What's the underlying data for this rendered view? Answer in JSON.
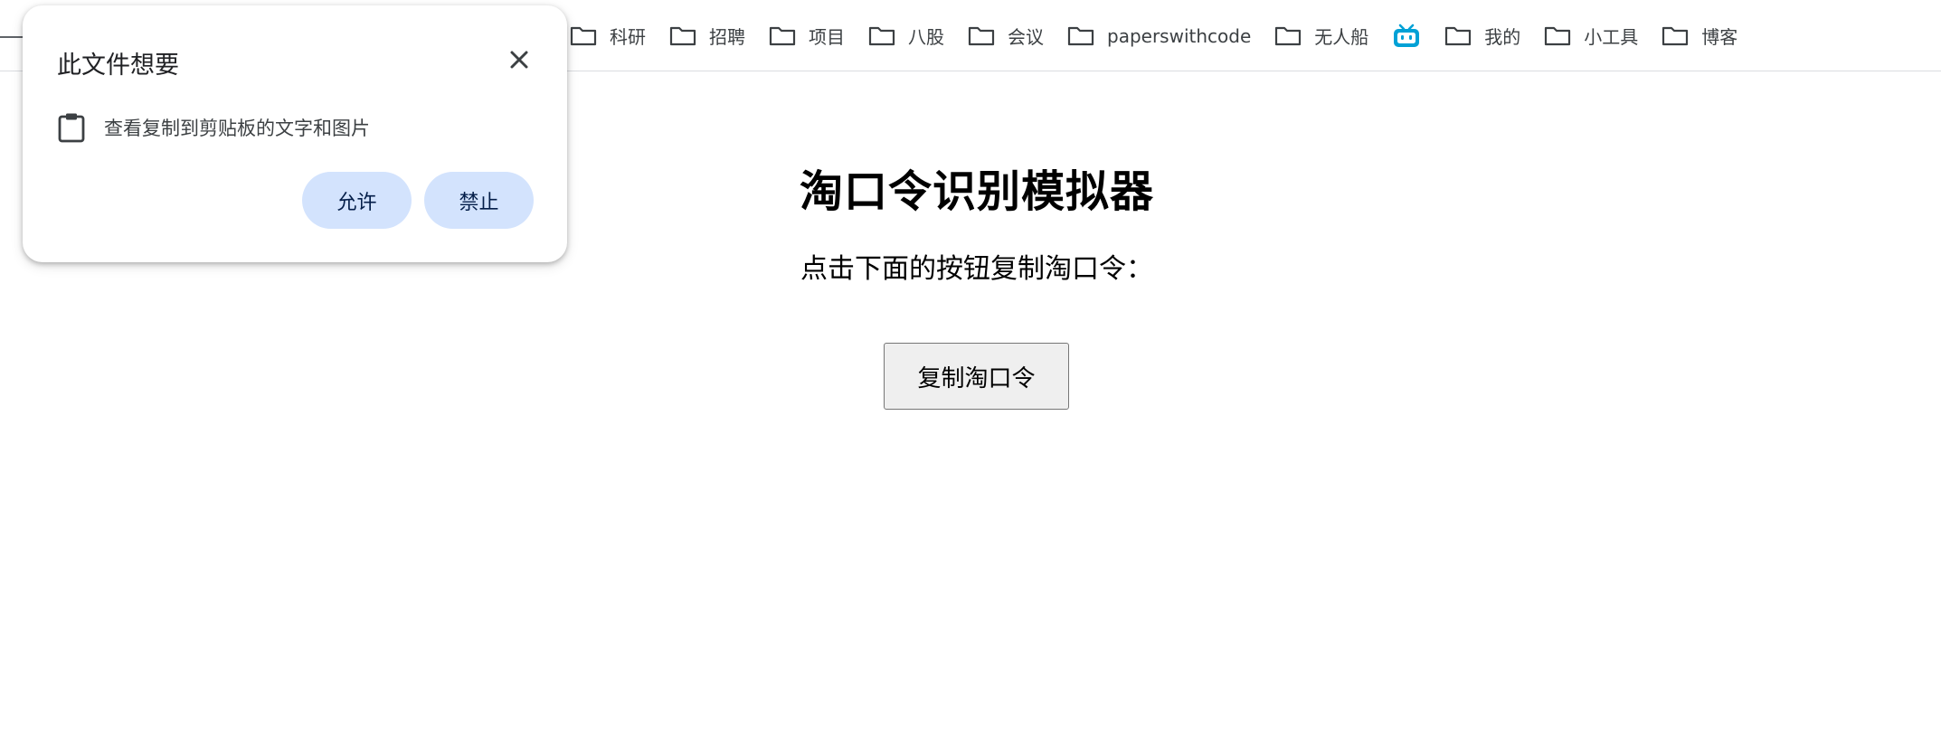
{
  "bookmarks_bar": {
    "items": [
      {
        "label": "科研",
        "icon": "folder-icon"
      },
      {
        "label": "招聘",
        "icon": "folder-icon"
      },
      {
        "label": "项目",
        "icon": "folder-icon"
      },
      {
        "label": "八股",
        "icon": "folder-icon"
      },
      {
        "label": "会议",
        "icon": "folder-icon"
      },
      {
        "label": "paperswithcode",
        "icon": "folder-icon"
      },
      {
        "label": "无人船",
        "icon": "folder-icon"
      },
      {
        "label": "",
        "icon": "bilibili-icon"
      },
      {
        "label": "我的",
        "icon": "folder-icon"
      },
      {
        "label": "小工具",
        "icon": "folder-icon"
      },
      {
        "label": "博客",
        "icon": "folder-icon"
      }
    ]
  },
  "popup": {
    "title": "此文件想要",
    "permission_text": "查看复制到剪贴板的文字和图片",
    "allow_label": "允许",
    "block_label": "禁止",
    "close_icon": "close-icon",
    "permission_icon": "clipboard-icon"
  },
  "main": {
    "title": "淘口令识别模拟器",
    "subtitle": "点击下面的按钮复制淘口令：",
    "copy_button_label": "复制淘口令"
  },
  "colors": {
    "pill_bg": "#d3e3fd",
    "pill_text": "#041e49",
    "bilibili": "#00a1d6",
    "button_bg": "#efefef"
  }
}
